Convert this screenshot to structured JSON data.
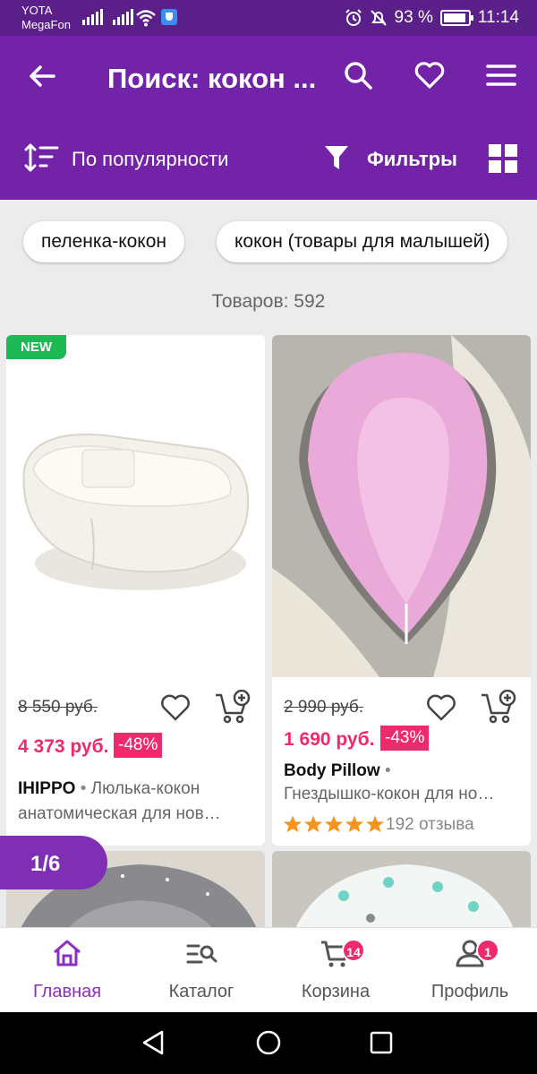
{
  "status_bar": {
    "carrier1": "YOTA",
    "carrier2": "MegaFon",
    "battery": "93 %",
    "time": "11:14"
  },
  "header": {
    "title": "Поиск: кокон ...",
    "sort_label": "По популярности",
    "filter_label": "Фильтры"
  },
  "chips": [
    "пеленка-кокон",
    "кокон (товары для малышей)"
  ],
  "results_count": "Товаров: 592",
  "products": [
    {
      "badge": "NEW",
      "old_price": "8 550 руб.",
      "price": "4 373 руб.",
      "discount": "-48%",
      "brand": "IHIPPO",
      "separator": "•",
      "name_line1": "Люлька-кокон",
      "name_line2": "анатомическая для нов…"
    },
    {
      "old_price": "2 990 руб.",
      "price": "1 690 руб.",
      "discount": "-43%",
      "brand": "Body Pillow",
      "separator": "•",
      "name": "Гнездышко-кокон для но…",
      "rating_stars": 5,
      "reviews": "192 отзыва"
    }
  ],
  "pager": "1/6",
  "bottom_nav": {
    "items": [
      {
        "label": "Главная",
        "icon": "home-icon",
        "active": true
      },
      {
        "label": "Каталог",
        "icon": "catalog-search-icon"
      },
      {
        "label": "Корзина",
        "icon": "cart-icon",
        "badge": "14"
      },
      {
        "label": "Профиль",
        "icon": "profile-icon",
        "badge": "1"
      }
    ]
  },
  "colors": {
    "header": "#7223a8",
    "status_bar": "#5b1f8a",
    "accent_pink": "#ee2a6b",
    "new_green": "#1db954",
    "active_nav": "#8a2fc0",
    "star": "#f7941d"
  }
}
